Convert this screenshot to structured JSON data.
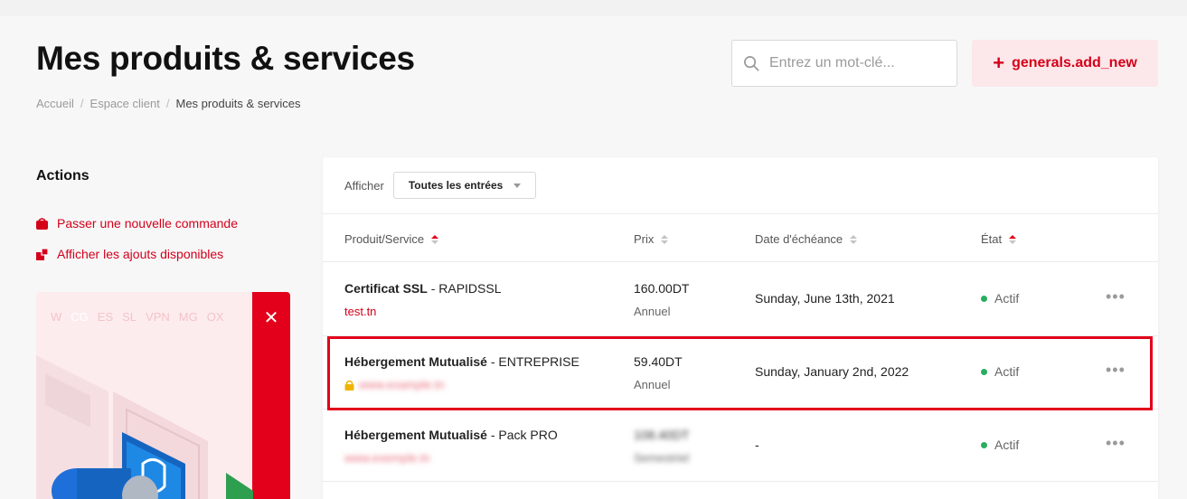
{
  "header": {
    "title": "Mes produits & services",
    "breadcrumb": [
      "Accueil",
      "Espace client",
      "Mes produits & services"
    ],
    "search_placeholder": "Entrez un mot-clé...",
    "add_label": "generals.add_new"
  },
  "actions": {
    "title": "Actions",
    "new_order": "Passer une nouvelle commande",
    "addons": "Afficher les ajouts disponibles"
  },
  "promo": {
    "tabs": [
      "W",
      "CG",
      "ES",
      "SL",
      "VPN",
      "MG",
      "OX"
    ]
  },
  "filter": {
    "label": "Afficher",
    "selected": "Toutes les entrées"
  },
  "table": {
    "columns": [
      "Produit/Service",
      "Prix",
      "Date d'échéance",
      "État"
    ],
    "rows": [
      {
        "product": "Certificat SSL",
        "plan": " - RAPIDSSL",
        "domain": "test.tn",
        "price": "160.00DT",
        "cycle": "Annuel",
        "due": "Sunday, June 13th, 2021",
        "status": "Actif"
      },
      {
        "product": "Hébergement Mutualisé",
        "plan": " - ENTREPRISE",
        "domain": "www.example.tn",
        "price": "59.40DT",
        "cycle": "Annuel",
        "due": "Sunday, January 2nd, 2022",
        "status": "Actif"
      },
      {
        "product": "Hébergement Mutualisé",
        "plan": " - Pack PRO",
        "domain": "www.exemple.tn",
        "price": "108.40DT",
        "cycle": "Semestriel",
        "due": "-",
        "status": "Actif"
      }
    ]
  },
  "colors": {
    "accent": "#e2001a",
    "link": "#d4001a",
    "status_active": "#27ae60"
  }
}
